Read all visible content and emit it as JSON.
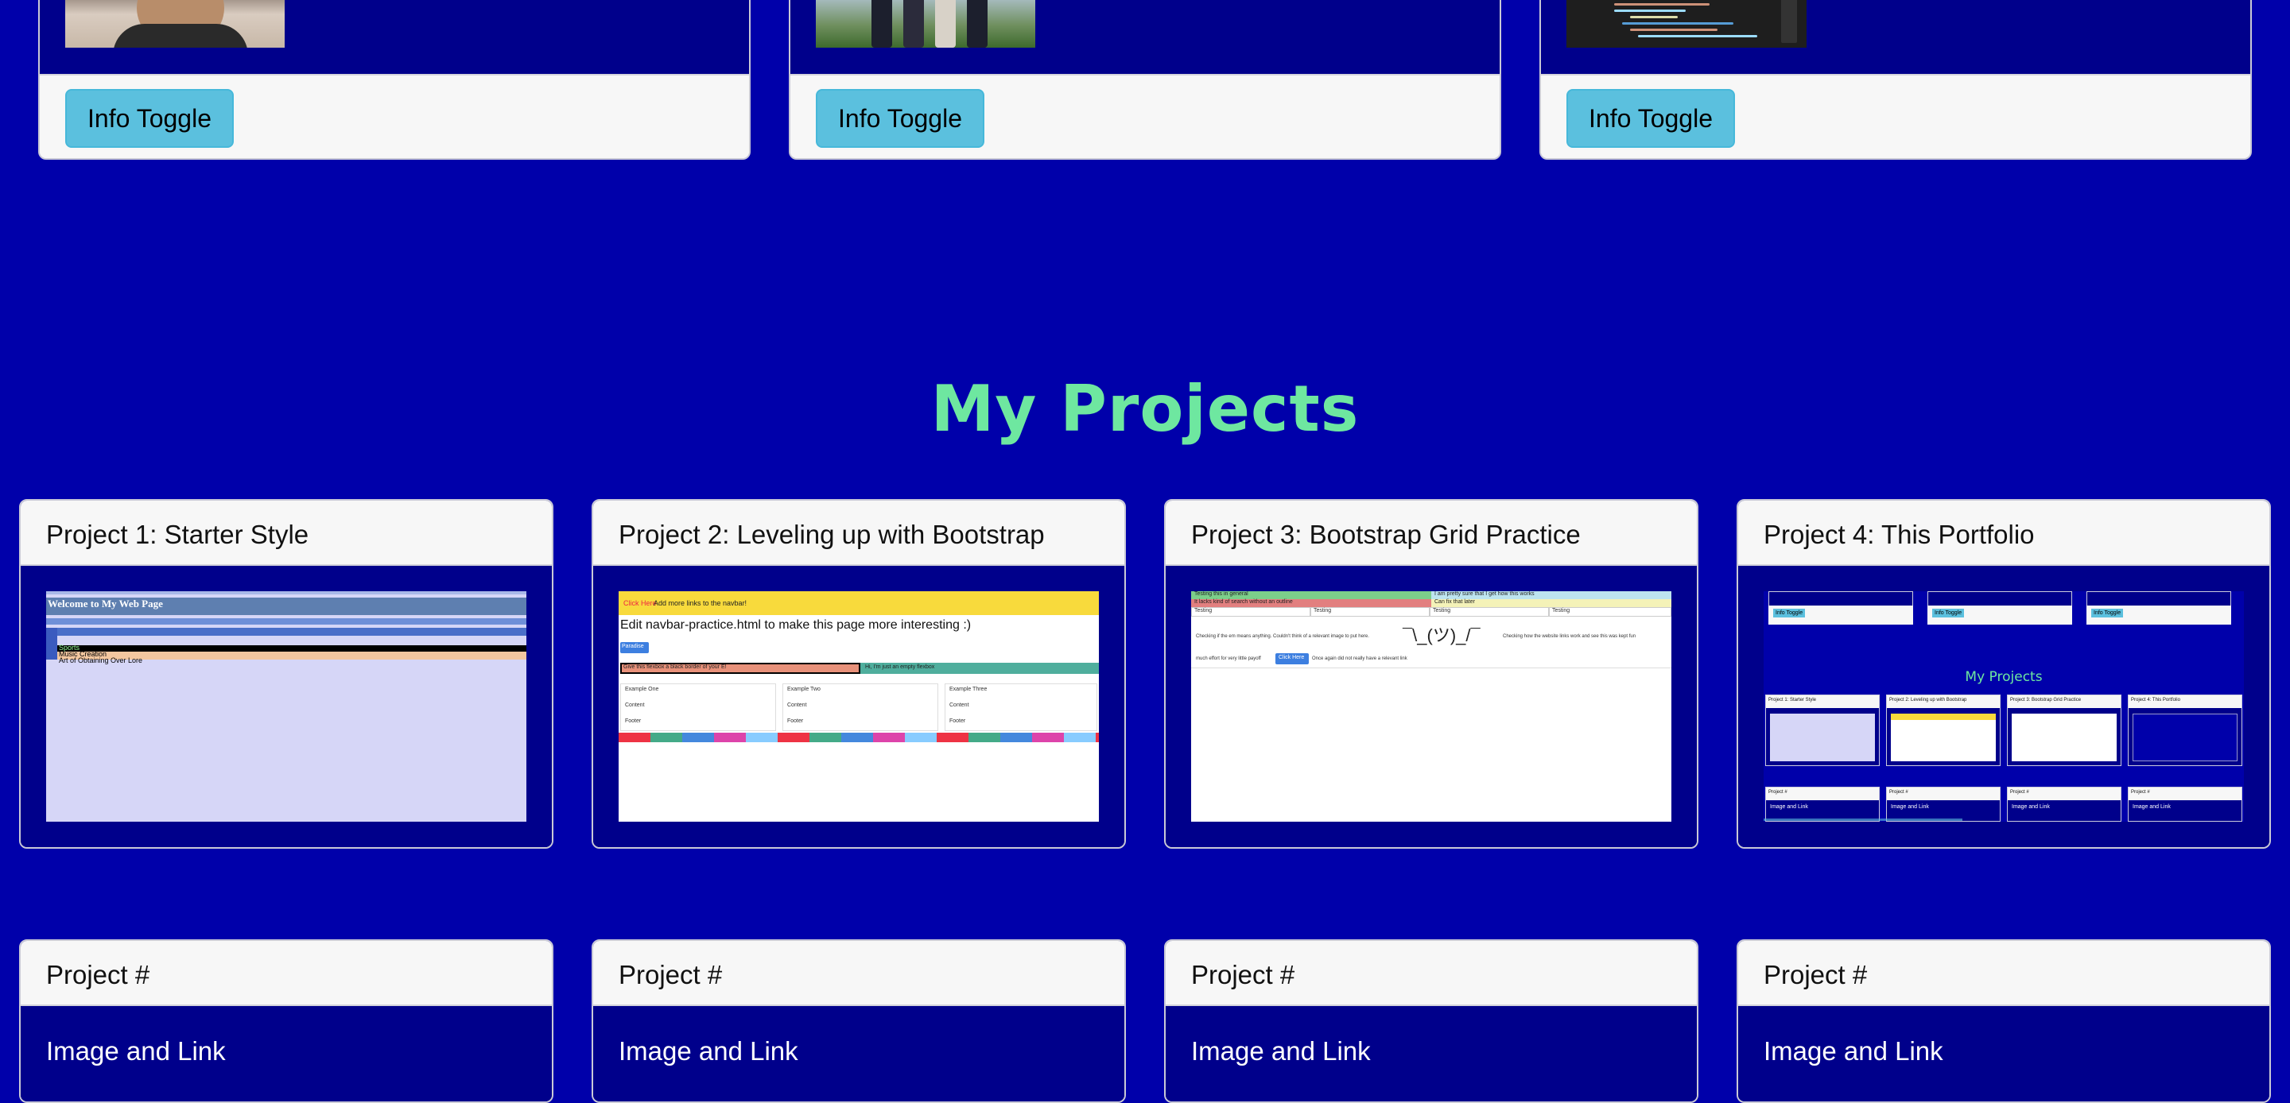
{
  "about_cards": [
    {
      "button_label": "Info Toggle",
      "image": "profile-photo"
    },
    {
      "button_label": "Info Toggle",
      "image": "group-photo"
    },
    {
      "button_label": "Info Toggle",
      "image": "code-screenshot"
    }
  ],
  "projects_section": {
    "title": "My Projects"
  },
  "projects": [
    {
      "title": "Project 1: Starter Style"
    },
    {
      "title": "Project 2: Leveling up with Bootstrap"
    },
    {
      "title": "Project 3: Bootstrap Grid Practice"
    },
    {
      "title": "Project 4: This Portfolio"
    }
  ],
  "placeholder_projects": [
    {
      "title": "Project #",
      "body": "Image and Link"
    },
    {
      "title": "Project #",
      "body": "Image and Link"
    },
    {
      "title": "Project #",
      "body": "Image and Link"
    },
    {
      "title": "Project #",
      "body": "Image and Link"
    }
  ],
  "thumb1": {
    "heading": "Welcome to My Web Page",
    "lines": [
      "Sports",
      "Music Creation",
      "Art of Obtaining Over Lore"
    ]
  },
  "thumb2": {
    "nav_link": "Click Here",
    "nav_text": "Add more links to the navbar!",
    "headline": "Edit navbar-practice.html to make this page more interesting :)",
    "button": "Paradise",
    "flexbox_left": "Give this flexbox a black border of your E!",
    "flexbox_right": "Hi, I'm just an empty flexbox",
    "cols": [
      "Example One",
      "Example Two",
      "Example Three"
    ],
    "row1": [
      "Content",
      "Content",
      "Content"
    ],
    "row2": [
      "Footer",
      "Footer",
      "Footer"
    ]
  },
  "thumb3": {
    "row1_left": "Testing this in general",
    "row1_right": "I am pretty sure that I get how this works",
    "row2_left": "It lacks kind of search without an outline",
    "row2_right": "Can fix that later",
    "testing": [
      "Testing",
      "Testing",
      "Testing",
      "Testing"
    ],
    "para1": "Checking if the em means anything. Couldn't think of a relevant image to put here.",
    "shrug": "¯\\_(ツ)_/¯",
    "para2": "Checking how the website links work and see this was kept fun",
    "para3": "much effort for very little payoff",
    "button": "Click Here",
    "para4": "Once again did not really have a relevant link"
  },
  "thumb4": {
    "title": "My Projects",
    "buttons": [
      "Info Toggle",
      "Info Toggle",
      "Info Toggle"
    ],
    "cards": [
      "Project 1: Starter Style",
      "Project 2: Leveling up with Bootstrap",
      "Project 3: Bootstrap Grid Practice",
      "Project 4: This Portfolio"
    ],
    "placeholders": [
      "Project #",
      "Project #",
      "Project #",
      "Project #"
    ],
    "placeholder_body": "Image and Link"
  }
}
